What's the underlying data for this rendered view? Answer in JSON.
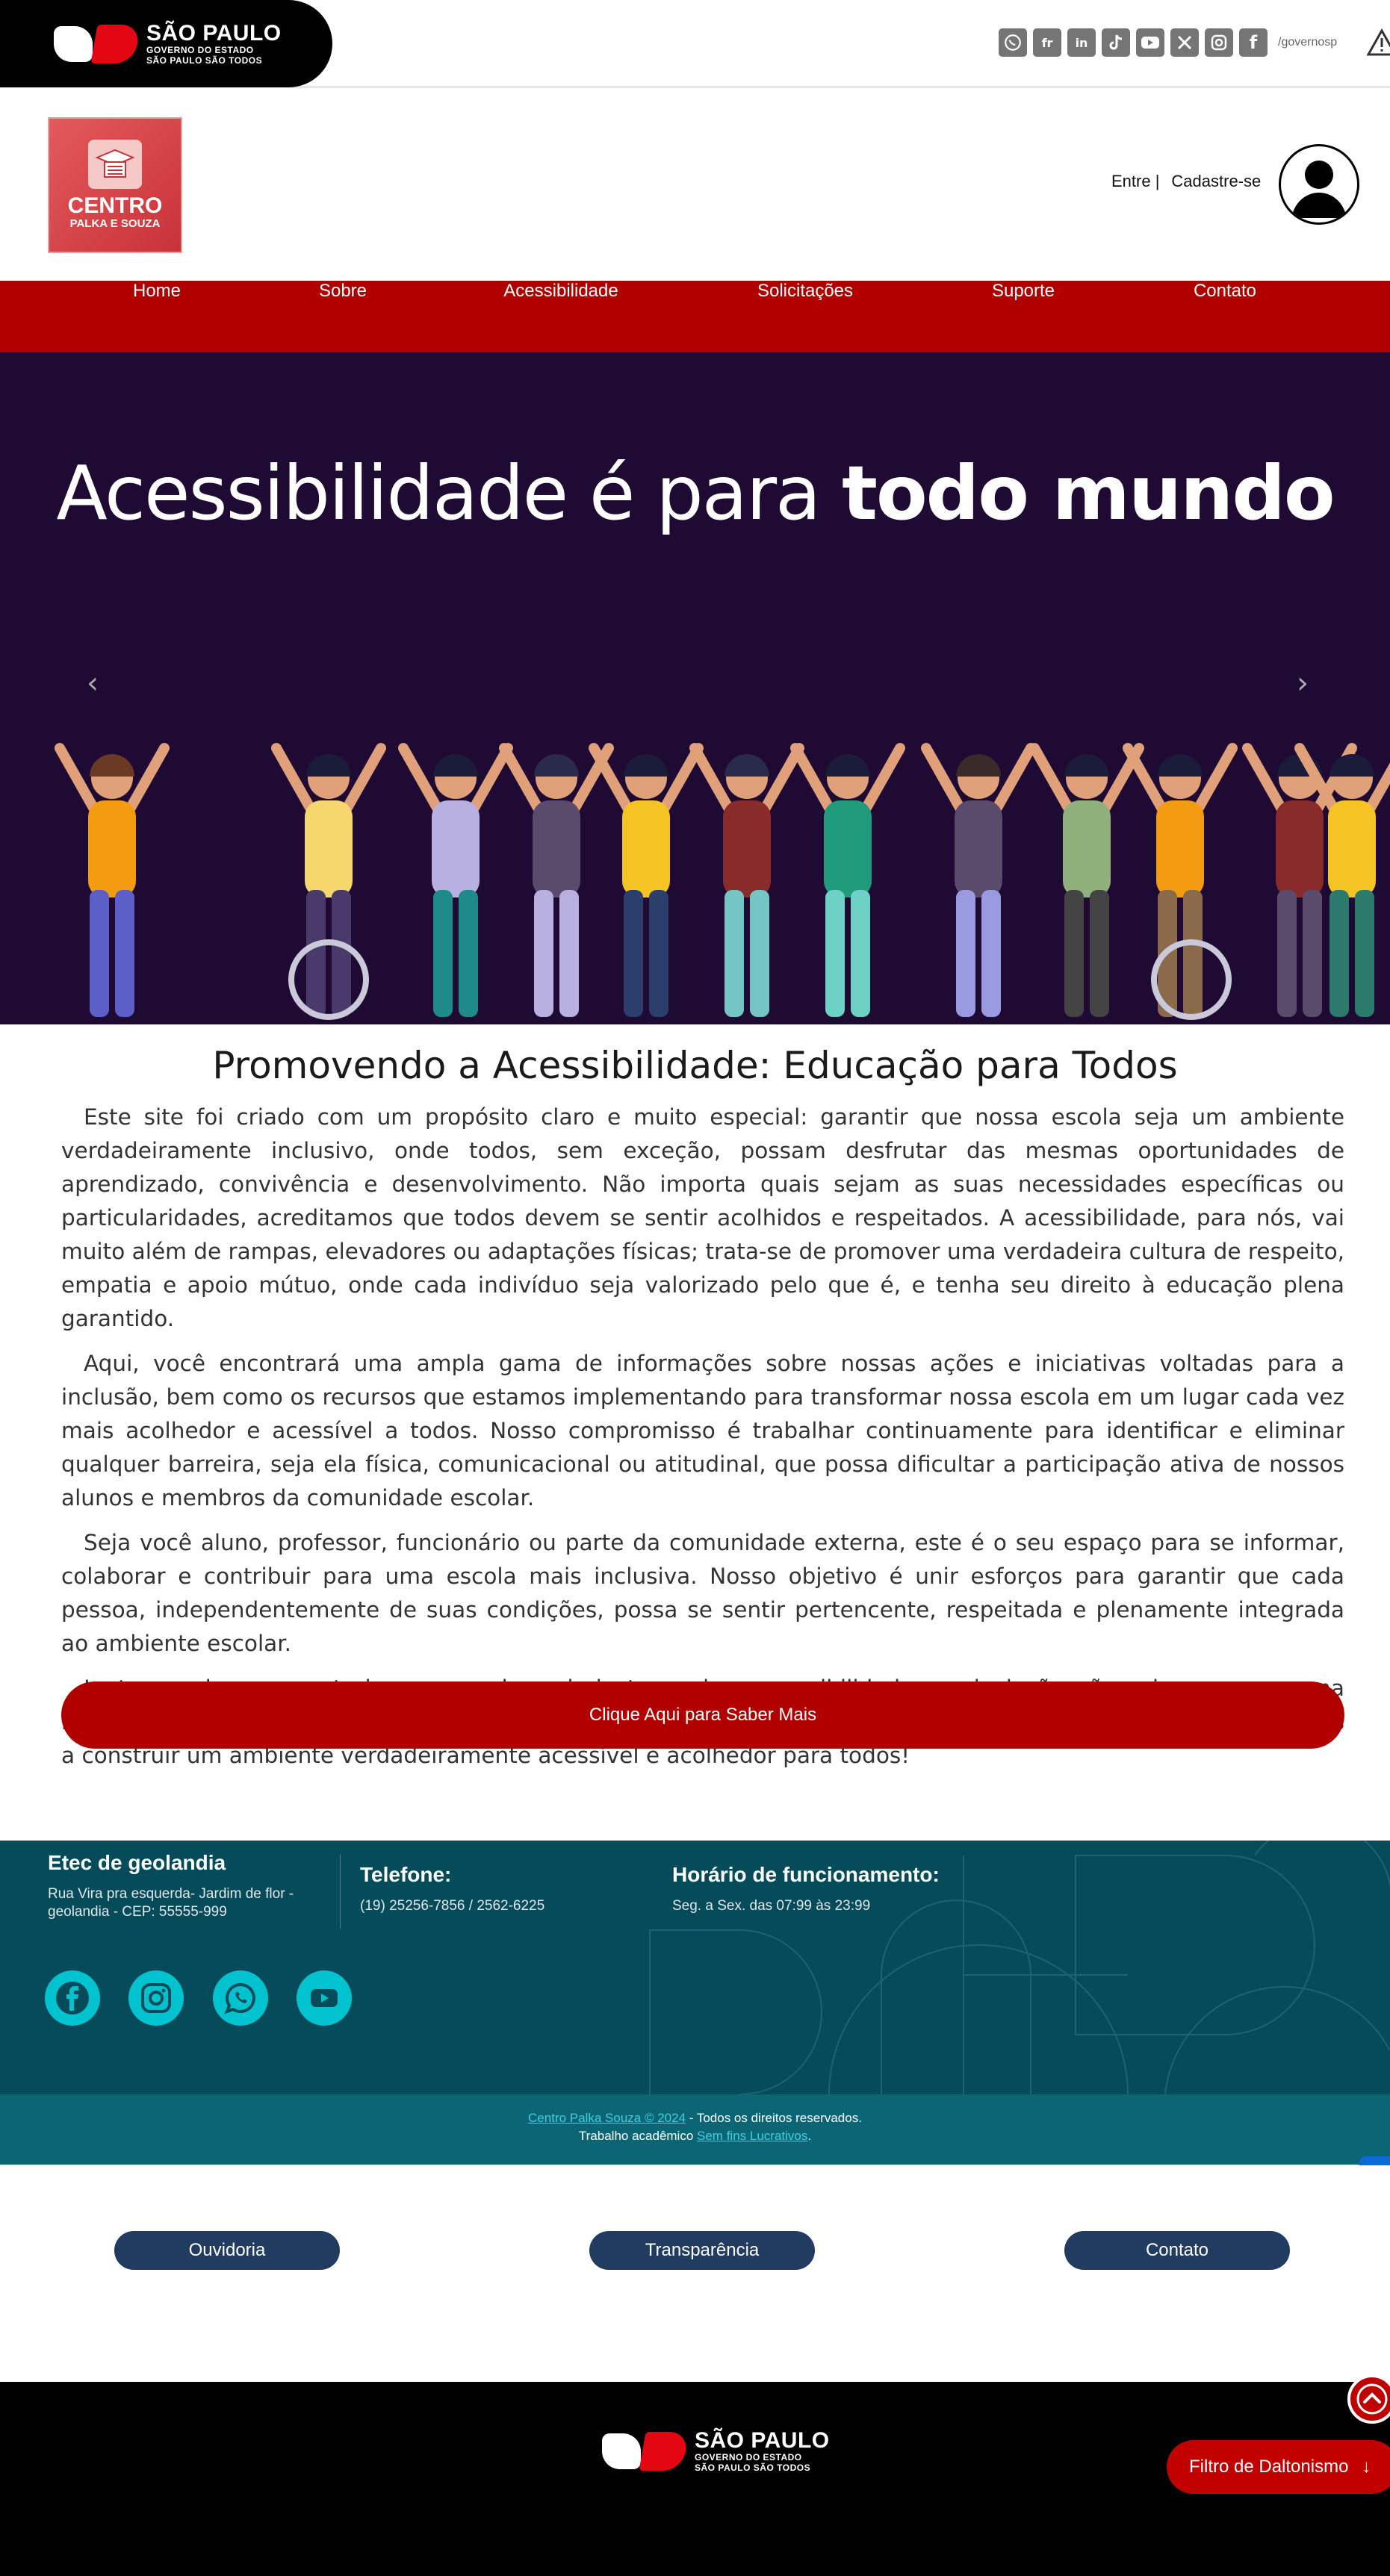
{
  "gov_bar": {
    "logo": {
      "title": "SÃO PAULO",
      "line2": "GOVERNO DO ESTADO",
      "line3": "SÃO PAULO SÃO TODOS"
    },
    "social_icons": [
      "whatsapp-icon",
      "flickr-icon",
      "linkedin-icon",
      "tiktok-icon",
      "youtube-icon",
      "x-icon",
      "instagram-icon",
      "facebook-icon"
    ],
    "handle": "/governosp"
  },
  "header": {
    "logo": {
      "title": "CENTRO",
      "subtitle": "PALKA E SOUZA"
    },
    "login": "Entre |",
    "register": "Cadastre-se"
  },
  "nav": {
    "items": [
      {
        "label": "Home"
      },
      {
        "label": "Sobre"
      },
      {
        "label": "Acessibilidade"
      },
      {
        "label": "Solicitações"
      },
      {
        "label": "Suporte"
      },
      {
        "label": "Contato"
      }
    ]
  },
  "hero": {
    "heading_regular": "Acessibilidade é para ",
    "heading_bold": "todo mundo",
    "prev_arrow": "‹",
    "next_arrow": "›"
  },
  "main": {
    "title": "Promovendo a Acessibilidade: Educação para Todos",
    "paragraphs": [
      "Este site foi criado com um propósito claro e muito especial: garantir que nossa escola seja um ambiente verdadeiramente inclusivo, onde todos, sem exceção, possam desfrutar das mesmas oportunidades de aprendizado, convivência e desenvolvimento. Não importa quais sejam as suas necessidades específicas ou particularidades, acreditamos que todos devem se sentir acolhidos e respeitados. A acessibilidade, para nós, vai muito além de rampas, elevadores ou adaptações físicas; trata-se de promover uma verdadeira cultura de respeito, empatia e apoio mútuo, onde cada indivíduo seja valorizado pelo que é, e tenha seu direito à educação plena garantido.",
      "Aqui, você encontrará uma ampla gama de informações sobre nossas ações e iniciativas voltadas para a inclusão, bem como os recursos que estamos implementando para transformar nossa escola em um lugar cada vez mais acolhedor e acessível a todos. Nosso compromisso é trabalhar continuamente para identificar e eliminar qualquer barreira, seja ela física, comunicacional ou atitudinal, que possa dificultar a participação ativa de nossos alunos e membros da comunidade escolar.",
      "Seja você aluno, professor, funcionário ou parte da comunidade externa, este é o seu espaço para se informar, colaborar e contribuir para uma escola mais inclusiva. Nosso objetivo é unir esforços para garantir que cada pessoa, independentemente de suas condições, possa se sentir pertencente, respeitada e plenamente integrada ao ambiente escolar.",
      "Juntos, podemos construir uma escola mais justa, onde a acessibilidade e a inclusão não sejam apenas uma meta, mas uma realidade constante e viva no nosso dia a dia. Venha fazer parte desta jornada conosco e ajude-nos a construir um ambiente verdadeiramente acessível e acolhedor para todos!"
    ],
    "cta": "Clique Aqui para Saber Mais"
  },
  "footer": {
    "col1": {
      "title": "Etec de geolandia",
      "address": "Rua Vira pra esquerda- Jardim de flor - geolandia - CEP: 55555-999"
    },
    "col2": {
      "title": "Telefone:",
      "text": "(19) 25256-7856 / 2562-6225"
    },
    "col3": {
      "title": "Horário de funcionamento:",
      "text": "Seg. a Sex. das 07:99 às 23:99"
    },
    "social_icons": [
      "facebook-icon",
      "instagram-icon",
      "whatsapp-icon",
      "youtube-icon"
    ],
    "copyright_link": "Centro Palka Souza © 2024",
    "copyright_rest": " - Todos os direitos reservados.",
    "academic_prefix": "Trabalho acadêmico ",
    "academic_link": "Sem fins Lucrativos",
    "academic_suffix": "."
  },
  "links_row": {
    "ouvidoria": "Ouvidoria",
    "transparencia": "Transparência",
    "contato": "Contato"
  },
  "bottom_logo": {
    "title": "SÃO PAULO",
    "line2": "GOVERNO DO ESTADO",
    "line3": "SÃO PAULO SÃO TODOS"
  },
  "daltonismo": {
    "label": "Filtro de Daltonismo",
    "arrow": "↓"
  },
  "colors": {
    "brand_red": "#b00000",
    "footer_teal": "#064b5a",
    "hero_bg": "#1e0a33",
    "pill_navy": "#223b60",
    "social_cyan": "#00c3cf"
  }
}
